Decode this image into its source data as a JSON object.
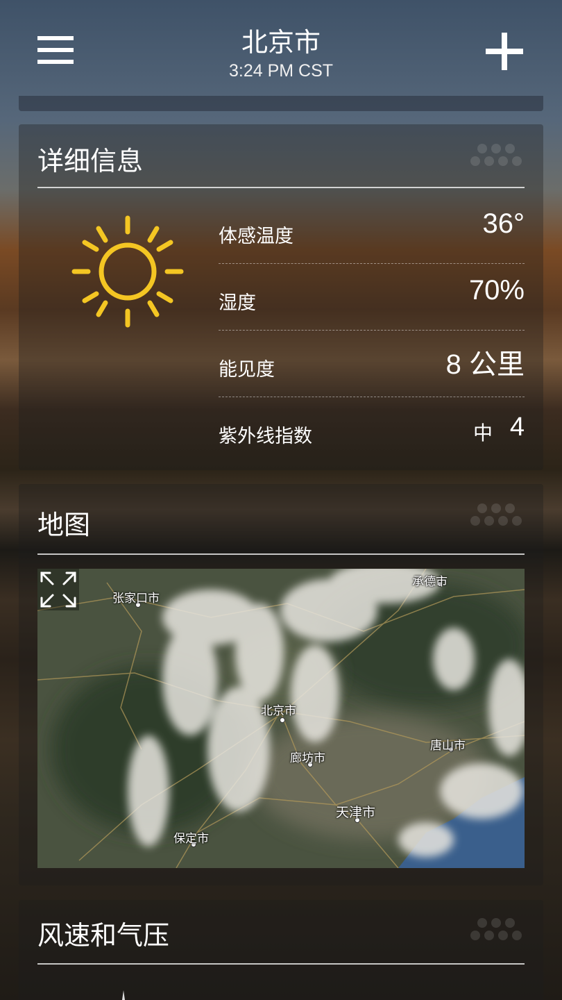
{
  "header": {
    "city": "北京市",
    "time": "3:24 PM CST"
  },
  "details": {
    "title": "详细信息",
    "condition_icon": "sun-icon",
    "rows": [
      {
        "label": "体感温度",
        "value": "36°"
      },
      {
        "label": "湿度",
        "value": "70%"
      },
      {
        "label": "能见度",
        "value": "8 公里"
      },
      {
        "label": "紫外线指数",
        "level": "中",
        "value": "4"
      }
    ]
  },
  "map": {
    "title": "地图",
    "labels": [
      "张家口市",
      "承德市",
      "北京市",
      "廊坊市",
      "唐山市",
      "天津市",
      "保定市"
    ]
  },
  "wind": {
    "title": "风速和气压"
  },
  "colors": {
    "sun": "#f4c623",
    "sea": "#3a5f8c"
  }
}
